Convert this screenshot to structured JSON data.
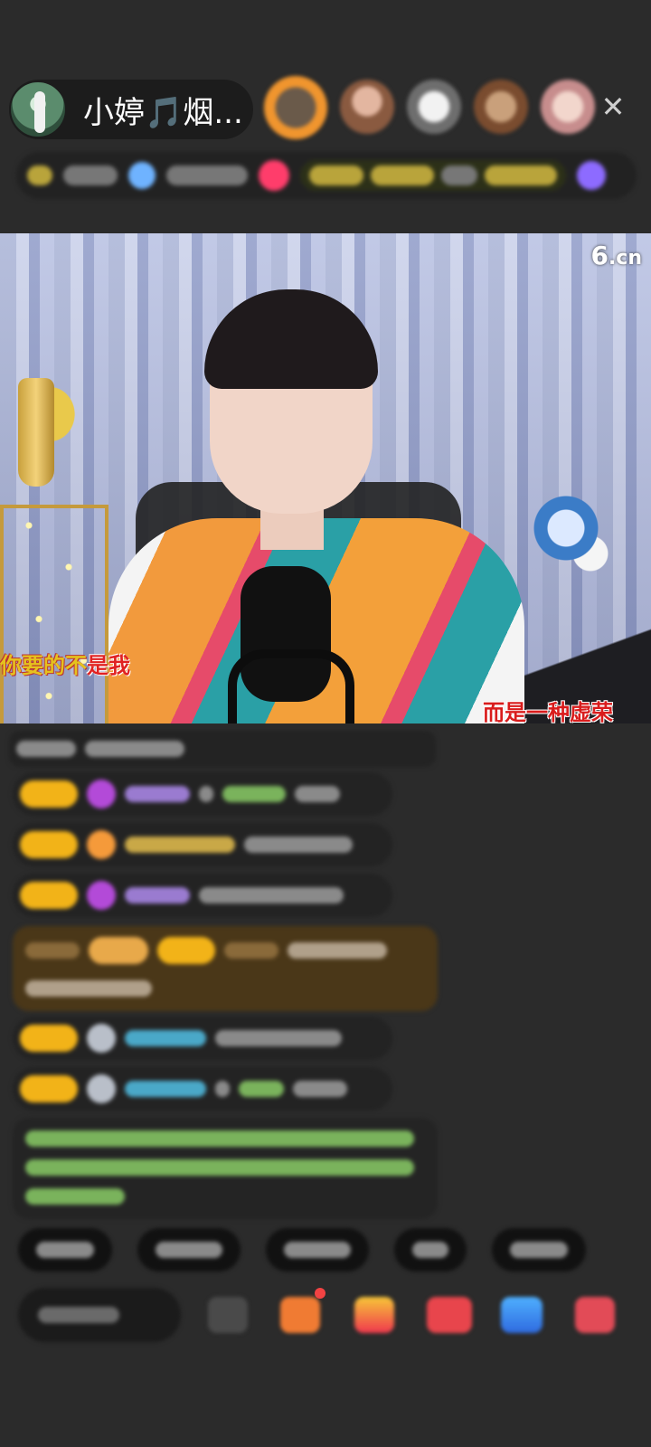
{
  "header": {
    "host_name": "小婷🎵烟...",
    "close_glyph": "✕"
  },
  "video": {
    "brand": "6",
    "brand_suffix": ".cn",
    "lyric_left_part1": "你要的不",
    "lyric_left_part2": "是我",
    "lyric_right": "而是一种虚荣"
  },
  "colors": {
    "background": "#2b2b2b",
    "badge_gold": "#f2b318",
    "highlight_brown": "#4a3718"
  }
}
